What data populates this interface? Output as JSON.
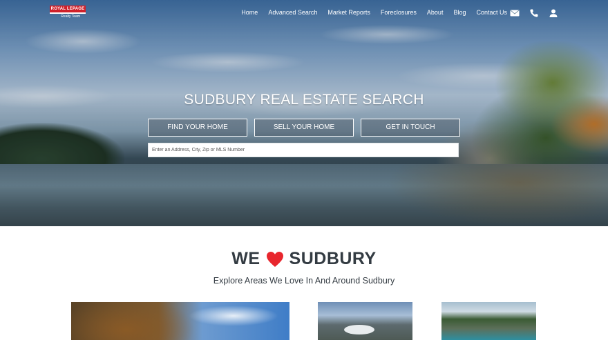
{
  "brand": {
    "logo_text": "ROYAL LEPAGE",
    "logo_sub": "Realty Team"
  },
  "nav": {
    "items": [
      {
        "label": "Home"
      },
      {
        "label": "Advanced Search"
      },
      {
        "label": "Market Reports"
      },
      {
        "label": "Foreclosures"
      },
      {
        "label": "About"
      },
      {
        "label": "Blog"
      },
      {
        "label": "Contact Us"
      }
    ],
    "icons": [
      "envelope-icon",
      "phone-icon",
      "user-icon"
    ]
  },
  "hero": {
    "title": "SUDBURY REAL ESTATE SEARCH",
    "buttons": [
      {
        "label": "FIND YOUR HOME"
      },
      {
        "label": "SELL YOUR HOME"
      },
      {
        "label": "GET IN TOUCH"
      }
    ],
    "search_placeholder": "Enter an Address, City, Zip or MLS Number"
  },
  "section": {
    "title_left": "WE",
    "title_right": "SUDBURY",
    "subtitle": "Explore Areas We Love In And Around Sudbury"
  },
  "colors": {
    "brand_red": "#d0202a",
    "heart_red": "#e8262d",
    "text_dark": "#333b42"
  }
}
